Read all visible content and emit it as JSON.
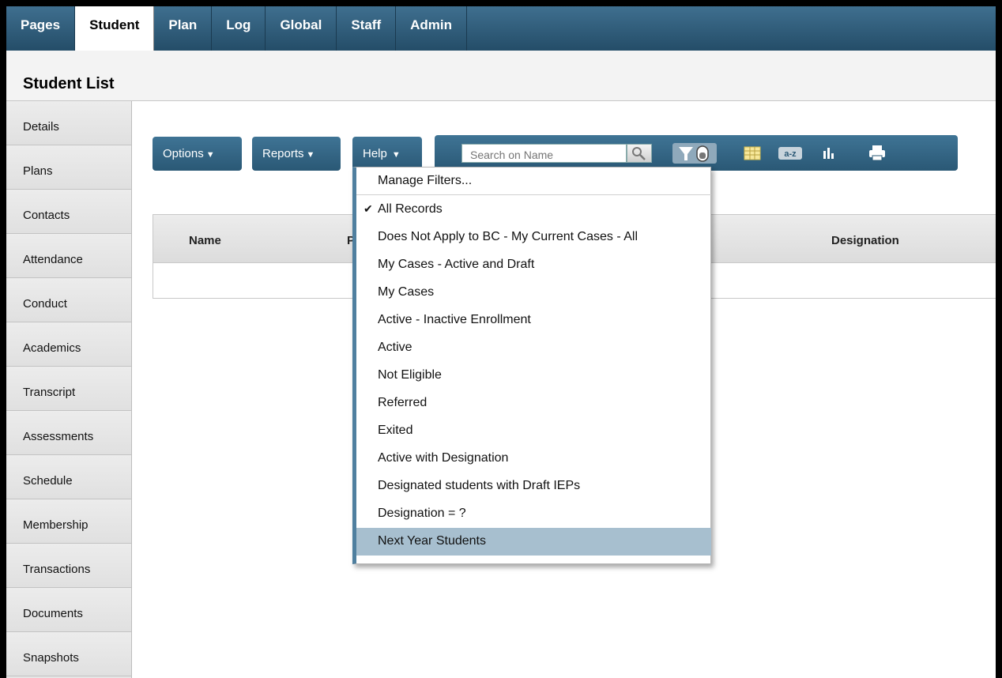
{
  "nav": {
    "tabs": [
      "Pages",
      "Student",
      "Plan",
      "Log",
      "Global",
      "Staff",
      "Admin"
    ],
    "active_tab": "Student"
  },
  "page": {
    "title": "Student List"
  },
  "sidebar": {
    "items": [
      "Details",
      "Plans",
      "Contacts",
      "Attendance",
      "Conduct",
      "Academics",
      "Transcript",
      "Assessments",
      "Schedule",
      "Membership",
      "Transactions",
      "Documents",
      "Snapshots"
    ]
  },
  "toolbar": {
    "options_label": "Options",
    "reports_label": "Reports",
    "help_label": "Help",
    "search_placeholder": "Search on Name",
    "icons": [
      "search-icon",
      "filter-icon",
      "grid-icon",
      "sort-az-icon",
      "chart-icon",
      "print-icon"
    ],
    "sort_label": "a-z"
  },
  "grid": {
    "columns": [
      "Name",
      "P",
      "Designation"
    ]
  },
  "filter_menu": {
    "items": [
      "Manage Filters...",
      "All Records",
      "Does Not Apply to BC - My Current Cases - All",
      "My Cases - Active and Draft",
      "My Cases",
      "Active - Inactive Enrollment",
      "Active",
      "Not Eligible",
      "Referred",
      "Exited",
      "Active with Designation",
      "Designated students with Draft IEPs",
      "Designation = ?",
      "Next Year Students"
    ],
    "checked_item": "All Records",
    "check_mark": "✔",
    "highlighted_item": "Next Year Students"
  },
  "colors": {
    "nav_blue": "#2f5d7c",
    "highlight": "#a7bfcf",
    "menu_border": "#4f7f9f"
  }
}
